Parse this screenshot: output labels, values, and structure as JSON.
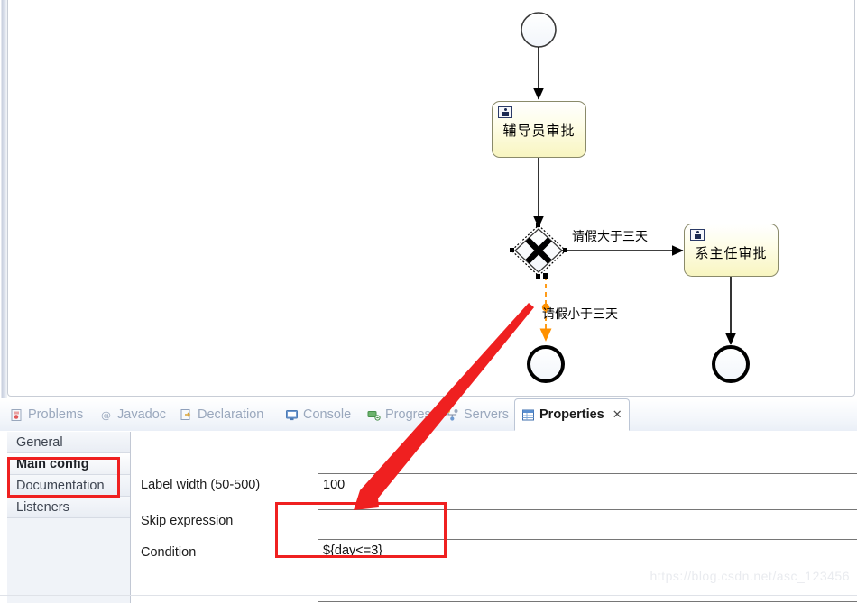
{
  "diagram": {
    "nodes": [
      {
        "id": "start-event",
        "type": "start-event",
        "label": ""
      },
      {
        "id": "task-counselor",
        "type": "user-task",
        "label": "辅导员审批"
      },
      {
        "id": "gateway-exclusive",
        "type": "exclusive-gateway",
        "label": "",
        "selected": true
      },
      {
        "id": "task-department-head",
        "type": "user-task",
        "label": "系主任审批"
      },
      {
        "id": "end-event-1",
        "type": "end-event",
        "label": ""
      },
      {
        "id": "end-event-2",
        "type": "end-event",
        "label": ""
      }
    ],
    "flows": [
      {
        "id": "flow-start-to-counselor",
        "label": ""
      },
      {
        "id": "flow-counselor-to-gateway",
        "label": ""
      },
      {
        "id": "flow-gateway-more-than-three-days",
        "label": "请假大于三天"
      },
      {
        "id": "flow-gateway-less-than-three-days",
        "label": "请假小于三天",
        "selected": true
      },
      {
        "id": "flow-head-to-end",
        "label": ""
      }
    ]
  },
  "view_tabs": [
    {
      "id": "problems",
      "label": "Problems",
      "icon": "problems-icon",
      "active": false
    },
    {
      "id": "javadoc",
      "label": "Javadoc",
      "icon": "javadoc-icon",
      "active": false
    },
    {
      "id": "declaration",
      "label": "Declaration",
      "icon": "declaration-icon",
      "active": false
    },
    {
      "id": "console",
      "label": "Console",
      "icon": "console-icon",
      "active": false
    },
    {
      "id": "progress",
      "label": "Progress",
      "icon": "progress-icon",
      "active": false
    },
    {
      "id": "servers",
      "label": "Servers",
      "icon": "servers-icon",
      "active": false
    },
    {
      "id": "properties",
      "label": "Properties",
      "icon": "properties-icon",
      "active": true,
      "close_glyph": "✕"
    }
  ],
  "properties": {
    "sections": [
      {
        "id": "general",
        "label": "General",
        "selected": false
      },
      {
        "id": "main-config",
        "label": "Main config",
        "selected": true
      },
      {
        "id": "documentation",
        "label": "Documentation",
        "selected": false
      },
      {
        "id": "listeners",
        "label": "Listeners",
        "selected": false
      }
    ],
    "fields": [
      {
        "id": "label-width",
        "label": "Label width (50-500)",
        "value": "100",
        "placeholder": ""
      },
      {
        "id": "skip-expression",
        "label": "Skip expression",
        "value": "",
        "placeholder": ""
      },
      {
        "id": "condition",
        "label": "Condition",
        "value": "${day<=3}",
        "placeholder": ""
      }
    ]
  },
  "annotations": {
    "highlight_main_config": "Main config",
    "highlight_condition": "${day<=3}",
    "arrow_color": "#ef2020",
    "rect_color": "#ef2020"
  },
  "watermark": "https://blog.csdn.net/asc_123456",
  "colors": {
    "task_fill": "#f8f5c0",
    "selected_flow": "#ff9100",
    "annotation_red": "#ef2020"
  }
}
